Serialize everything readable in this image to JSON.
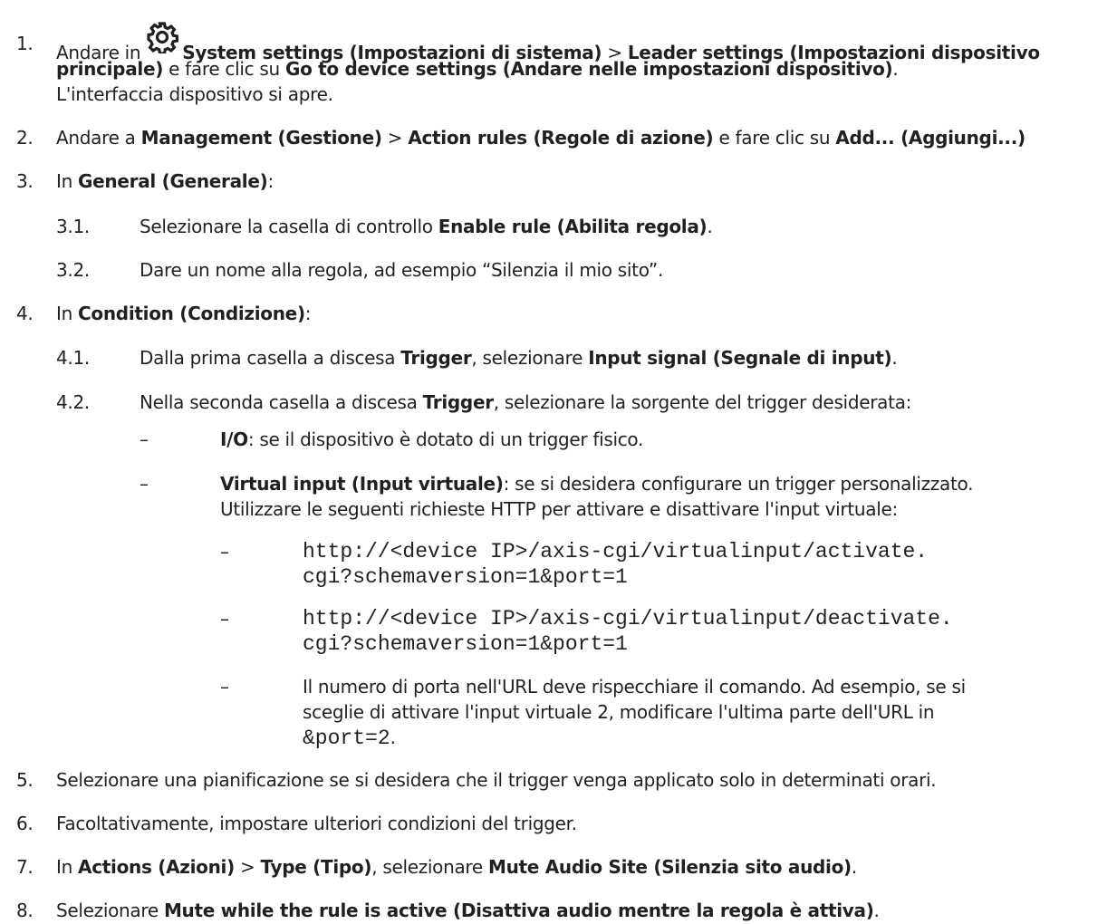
{
  "steps": [
    {
      "num": "1.",
      "l1_pre": "Andare in",
      "l1_b1": "System settings (Impostazioni di sistema)",
      "l1_sep": " > ",
      "l1_b2": "Leader settings (Impostazioni dispositivo",
      "l2_b": "principale)",
      "l2_mid": " e fare clic su ",
      "l2_b2": "Go to device settings (Andare nelle impostazioni dispositivo)",
      "l2_end": ".",
      "l3": "L'interfaccia dispositivo si apre.",
      "icon": "gear-icon"
    },
    {
      "num": "2.",
      "t1": "Andare a ",
      "b1": "Management (Gestione)",
      "t2": " > ",
      "b2": "Action rules (Regole di azione)",
      "t3": " e fare clic su ",
      "b3": "Add... (Aggiungi...)"
    },
    {
      "num": "3.",
      "t1": "In ",
      "b1": "General (Generale)",
      "t2": ":"
    },
    {
      "num": "3.1.",
      "t1": "Selezionare la casella di controllo ",
      "b1": "Enable rule (Abilita regola)",
      "t2": "."
    },
    {
      "num": "3.2.",
      "t1": "Dare un nome alla regola, ad esempio “Silenzia il mio sito”."
    },
    {
      "num": "4.",
      "t1": "In ",
      "b1": "Condition (Condizione)",
      "t2": ":"
    },
    {
      "num": "4.1.",
      "t1": "Dalla prima casella a discesa ",
      "b1": "Trigger",
      "t2": ", selezionare ",
      "b2": "Input signal (Segnale di input)",
      "t3": "."
    },
    {
      "num": "4.2.",
      "t1": "Nella seconda casella a discesa ",
      "b1": "Trigger",
      "t2": ", selezionare la sorgente del trigger desiderata:"
    },
    {
      "num": "–",
      "b1": "I/O",
      "t1": ": se il dispositivo è dotato di un trigger fisico."
    },
    {
      "num": "–",
      "b1": "Virtual input (Input virtuale)",
      "t1": ": se si desidera configurare un trigger personalizzato.",
      "l2": "Utilizzare le seguenti richieste HTTP per attivare e disattivare l'input virtuale:"
    },
    {
      "num": "–",
      "l1": "http://<device IP>/axis-cgi/virtualinput/activate.",
      "l2": "cgi?schemaversion=1&port=1"
    },
    {
      "num": "–",
      "l1": "http://<device IP>/axis-cgi/virtualinput/deactivate.",
      "l2": "cgi?schemaversion=1&port=1"
    },
    {
      "num": "–",
      "l1": "Il numero di porta nell'URL deve rispecchiare il comando. Ad esempio, se si",
      "l2": "sceglie di attivare l'input virtuale 2, modificare l'ultima parte dell'URL in",
      "l3_code": "&port=2",
      "l3_end": "."
    },
    {
      "num": "5.",
      "t1": "Selezionare una pianificazione se si desidera che il trigger venga applicato solo in determinati orari."
    },
    {
      "num": "6.",
      "t1": "Facoltativamente, impostare ulteriori condizioni del trigger."
    },
    {
      "num": "7.",
      "t1": "In ",
      "b1": "Actions (Azioni)",
      "t2": " > ",
      "b2": "Type (Tipo)",
      "t3": ", selezionare ",
      "b3": "Mute Audio Site (Silenzia sito audio)",
      "t4": "."
    },
    {
      "num": "8.",
      "t1": "Selezionare ",
      "b1": "Mute while the rule is active (Disattiva audio mentre la regola è attiva)",
      "t2": "."
    }
  ]
}
